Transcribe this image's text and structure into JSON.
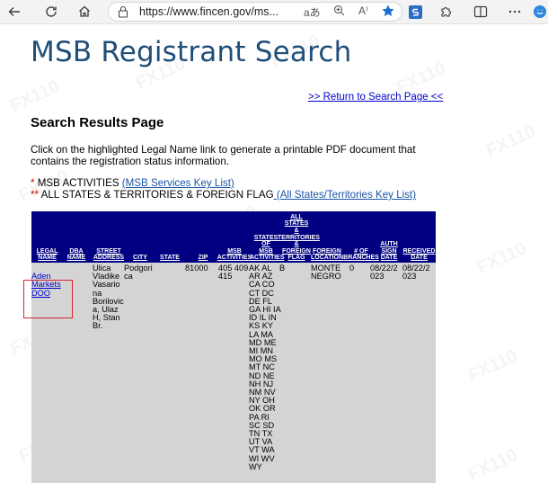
{
  "browser": {
    "url": "https://www.fincen.gov/ms...",
    "read_aloud_glyph": "aあ",
    "reader_glyph": "A⁾"
  },
  "page": {
    "title": "MSB Registrant Search",
    "return_link": ">> Return to Search Page <<",
    "heading": "Search Results Page",
    "instructions": "Click on the highlighted Legal Name link to generate a printable PDF document that contains the registration status information.",
    "legend": {
      "activities_star": "*",
      "activities_text": " MSB ACTIVITIES ",
      "activities_link": "(MSB Services Key List)",
      "states_star": "**",
      "states_text": " ALL STATES & TERRITORIES & FOREIGN FLAG",
      "states_link": " (All States/Territories Key List)"
    }
  },
  "table": {
    "headers": {
      "legal_name": "LEGAL\nNAME",
      "dba_name": "DBA\nNAME",
      "street_address": "STREET\nADDRESS",
      "city": "CITY",
      "state": "STATE",
      "zip": "ZIP",
      "msb_activities": "MSB\nACTIVITIES",
      "states_of_msb_activities": "STATES\nOF\nMSB\nACTIVITIES",
      "all_states_territories_foreign_flag": "ALL\nSTATES\n&\nTERRITORIES\n&\nFOREIGN\nFLAG",
      "foreign_location": "FOREIGN\nLOCATION",
      "num_branches": "# OF\nBRANCHES",
      "auth_sign_date": "AUTH\nSIGN\nDATE",
      "received_date": "RECEIVED\nDATE"
    },
    "row": {
      "legal_name": "Aden\nMarkets\nDOO",
      "dba_name": "",
      "street_address": "Ulica\nVladike\nVasario\nna\nBorilovic\na, Ulaz\nH, Stan\nBr.",
      "city": "Podgori\nca",
      "state": "",
      "zip": "81000",
      "msb_activities": "405 409\n415",
      "states": "AK AL\nAR AZ\nCA CO\nCT DC\nDE FL\nGA HI IA\nID IL IN\nKS KY\nLA MA\nMD ME\nMI MN\nMO MS\nMT NC\nND NE\nNH NJ\nNM NV\nNY OH\nOK OR\nPA RI\nSC SD\nTN TX\nUT VA\nVT WA\nWI WV\nWY",
      "foreign_flag": "B",
      "foreign_location": "MONTE\nNEGRO",
      "num_branches": "0",
      "auth_sign_date": "08/22/2\n023",
      "received_date": "08/22/2\n023"
    }
  },
  "colors": {
    "title": "#1f4e79",
    "header_bg": "#000080",
    "row_bg": "#d4d4d4",
    "highlight": "#d9232e",
    "link": "#0000cc"
  }
}
